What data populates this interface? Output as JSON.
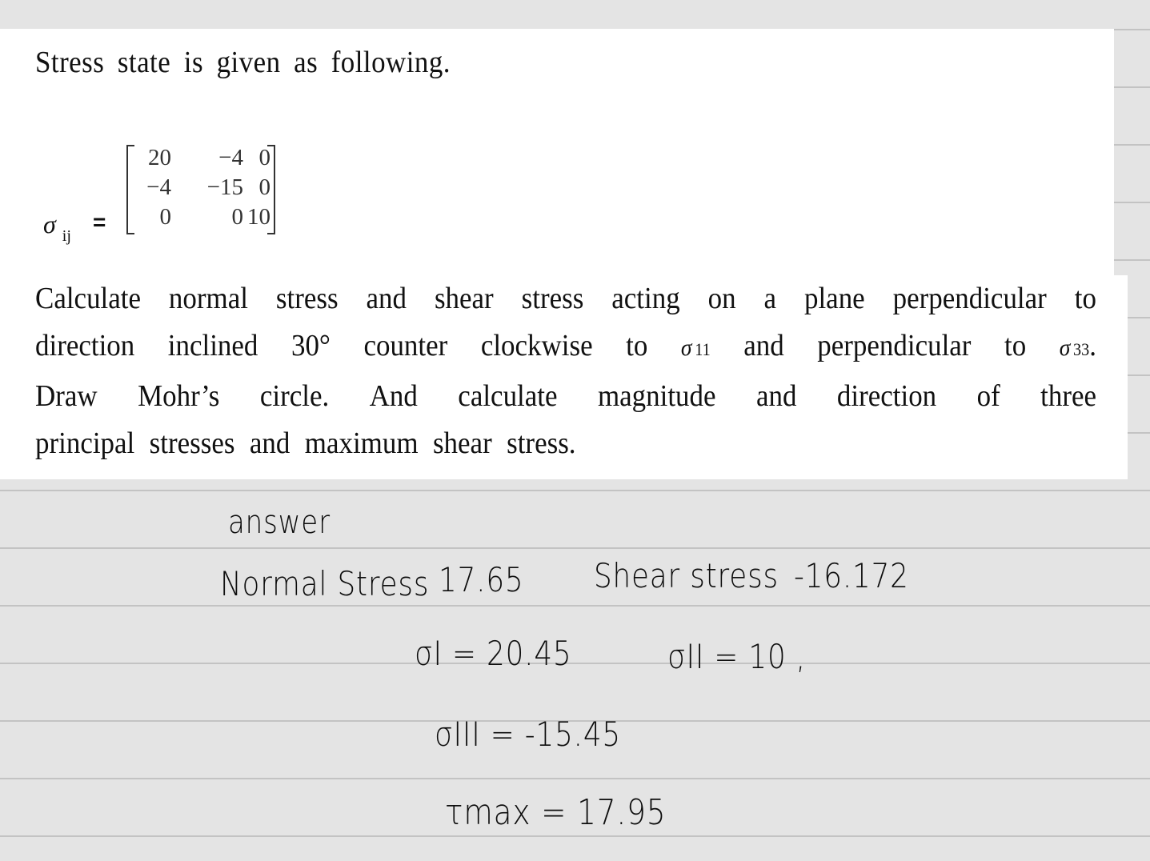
{
  "problem": {
    "intro": "Stress state is given as following.",
    "tensor_label": "σ",
    "tensor_subscript": "ij",
    "equals": "=",
    "matrix": [
      [
        "20",
        "−4",
        "0"
      ],
      [
        "−4",
        "−15",
        "0"
      ],
      [
        "0",
        "0",
        "10"
      ]
    ],
    "paragraph_lines": [
      [
        "Calculate",
        "normal",
        "stress",
        "and",
        "shear",
        "stress",
        "acting",
        "on",
        "a",
        "plane",
        "perpendicular",
        "to"
      ],
      [
        "direction",
        "inclined",
        "30°",
        "counter",
        "clockwise",
        "to"
      ],
      [
        "Draw",
        "Mohr’s",
        "circle.",
        "And",
        "calculate",
        "magnitude",
        "and",
        "direction",
        "of",
        "three"
      ],
      [
        "principal",
        "stresses",
        "and",
        "maximum",
        "shear",
        "stress."
      ]
    ],
    "line2_sigma1": {
      "symbol": "σ",
      "sub": "11"
    },
    "line2_middle": "and perpendicular to",
    "line2_sigma2": {
      "symbol": "σ",
      "sub": "33",
      "suffix": "."
    }
  },
  "handwritten_answer": {
    "heading": "answer",
    "normal_stress_label": "Normal Stress",
    "normal_stress_value": "17.65",
    "shear_stress_label": "Shear stress",
    "shear_stress_value": "-16.172",
    "sigma_1": "σI = 20.45",
    "sigma_2": "σII = 10 ,",
    "sigma_3": "σIII = -15.45",
    "tau_max": "τmax = 17.95"
  }
}
